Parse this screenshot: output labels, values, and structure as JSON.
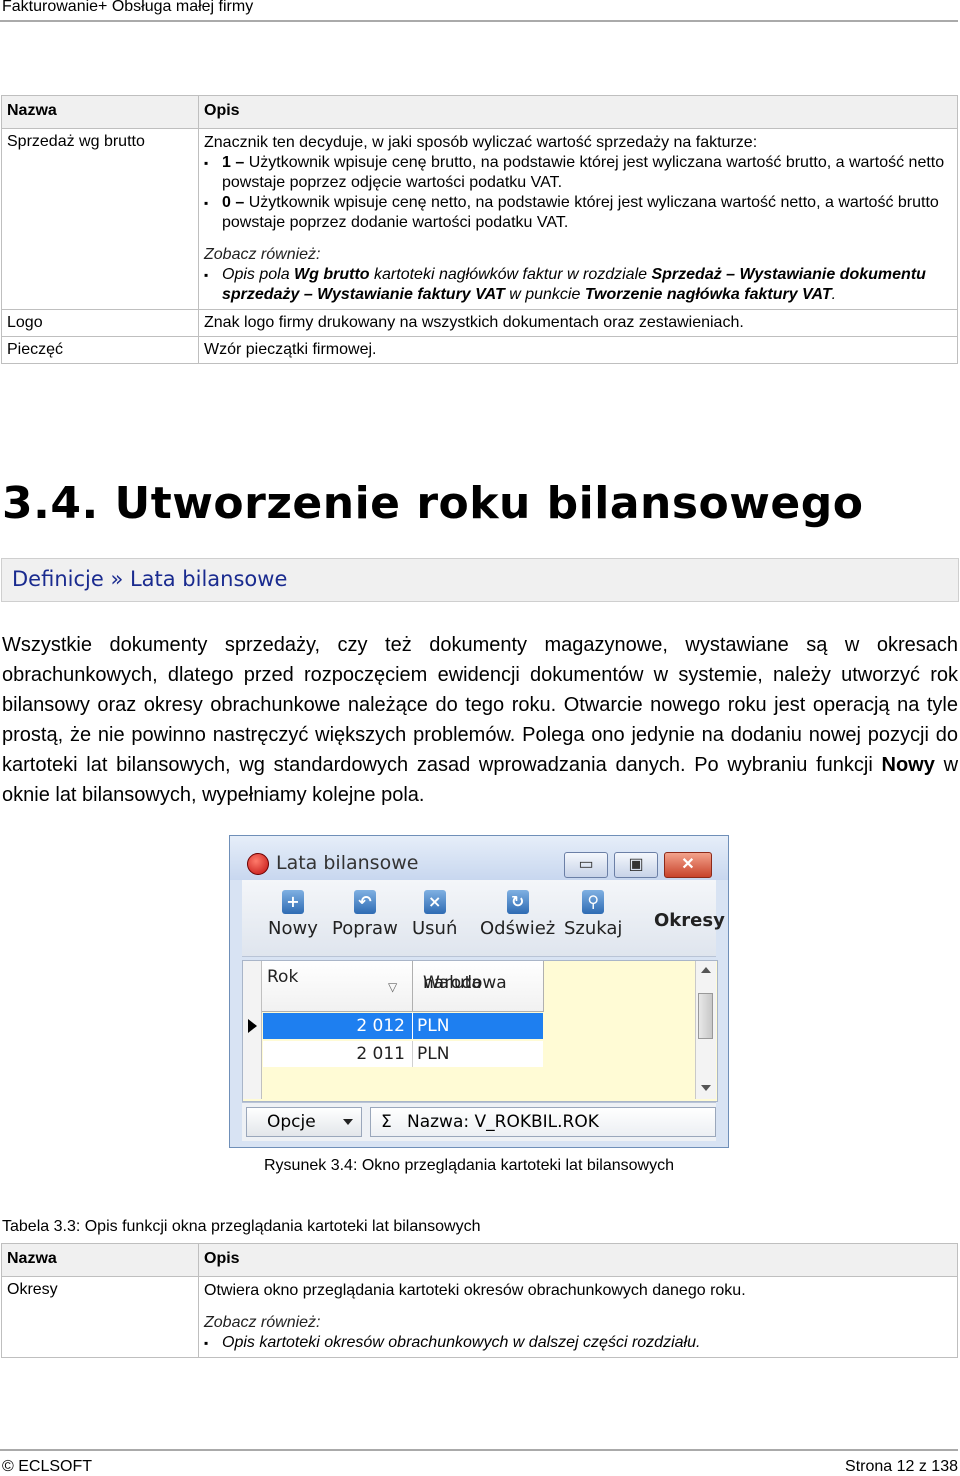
{
  "header": {
    "title": "Fakturowanie+ Obsługa małej firmy"
  },
  "table1": {
    "col_name": "Nazwa",
    "col_desc": "Opis",
    "rows": [
      {
        "name": "Sprzedaż wg brutto",
        "intro": "Znacznik ten decyduje, w jaki sposób wyliczać wartość sprzedaży na fakturze:",
        "bullet1_bold": "1 –",
        "bullet1_text": " Użytkownik wpisuje cenę brutto, na podstawie której jest wyliczana wartość brutto, a wartość netto powstaje poprzez odjęcie wartości podatku VAT.",
        "bullet2_bold": "0 –",
        "bullet2_text": " Użytkownik wpisuje cenę netto, na podstawie której jest wyliczana wartość netto, a wartość brutto powstaje poprzez dodanie wartości podatku VAT.",
        "see_also": "Zobacz również:",
        "see_p1": "Opis pola ",
        "see_b1": "Wg brutto",
        "see_p2": " kartoteki nagłówków faktur w rozdziale ",
        "see_b2": "Sprzedaż – Wystawianie dokumentu sprzedaży – Wystawianie faktury VAT",
        "see_p3": " w punkcie ",
        "see_b3": "Tworzenie nagłówka faktury VAT",
        "see_p4": "."
      },
      {
        "name": "Logo",
        "desc": "Znak logo firmy drukowany na wszystkich dokumentach oraz zestawieniach."
      },
      {
        "name": "Pieczęć",
        "desc": "Wzór pieczątki firmowej."
      }
    ]
  },
  "section": {
    "heading": "3.4. Utworzenie roku bilansowego",
    "path": "Definicje » Lata bilansowe",
    "para_pre": "Wszystkie dokumenty sprzedaży, czy też dokumenty magazynowe, wystawiane są w okresach obrachunkowych, dlatego przed rozpoczęciem ewidencji dokumentów w systemie, należy utworzyć rok bilansowy oraz okresy obrachunkowe należące do tego roku. Otwarcie nowego roku jest operacją na tyle prostą, że nie powinno nastręczyć większych problemów. Polega ono jedynie na dodaniu nowej pozycji do kartoteki lat bilansowych, wg standardowych zasad wprowadzania danych. Po wybraniu funkcji ",
    "para_bold": "Nowy",
    "para_post": " w oknie lat bilansowych, wypełniamy kolejne pola."
  },
  "window": {
    "title": "Lata bilansowe",
    "btn_min": "▭",
    "btn_max": "▣",
    "btn_close": "✕",
    "toolbar": [
      {
        "label": "Nowy",
        "glyph": "+"
      },
      {
        "label": "Popraw",
        "glyph": "↶"
      },
      {
        "label": "Usuń",
        "glyph": "×"
      },
      {
        "label": "Odśwież",
        "glyph": "↻"
      },
      {
        "label": "Szukaj",
        "glyph": "⚲"
      }
    ],
    "okresy": "Okresy",
    "grid": {
      "col1": "Rok",
      "col2_line1": "Waluta",
      "col2_line2": "narodowa",
      "sort_glyph": "▽",
      "rows": [
        {
          "year": "2 012",
          "currency": "PLN"
        },
        {
          "year": "2 011",
          "currency": "PLN"
        }
      ]
    },
    "opcje": "Opcje",
    "sigma": "Σ",
    "nazwa": "Nazwa: V_ROKBIL.ROK"
  },
  "figure_caption": "Rysunek 3.4: Okno przeglądania kartoteki lat bilansowych",
  "table2": {
    "caption": "Tabela 3.3: Opis funkcji okna przeglądania kartoteki lat bilansowych",
    "col_name": "Nazwa",
    "col_desc": "Opis",
    "row_name": "Okresy",
    "row_desc": "Otwiera okno przeglądania kartoteki okresów obrachunkowych danego roku.",
    "see_also": "Zobacz również:",
    "see_item": "Opis kartoteki okresów obrachunkowych w dalszej części rozdziału."
  },
  "footer": {
    "left": "© ECLSOFT",
    "right": "Strona 12 z 138"
  }
}
